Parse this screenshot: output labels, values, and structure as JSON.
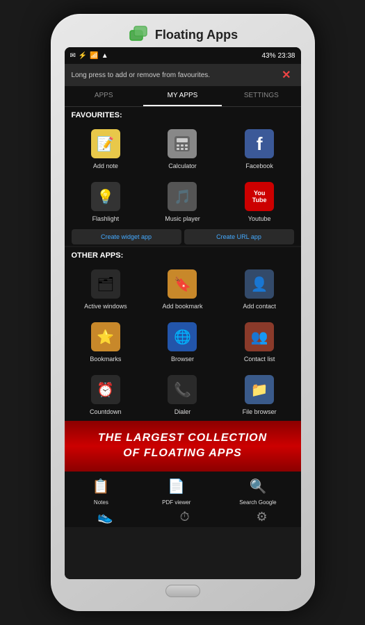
{
  "app": {
    "title": "Floating Apps"
  },
  "statusBar": {
    "time": "23:38",
    "battery": "43%",
    "signal": "▲"
  },
  "notice": {
    "text": "Long press to add or remove from favourites.",
    "closeLabel": "✕"
  },
  "tabs": [
    {
      "label": "APPS",
      "active": false
    },
    {
      "label": "MY APPS",
      "active": true
    },
    {
      "label": "SETTINGS",
      "active": false
    }
  ],
  "favourites": {
    "label": "FAVOURITES:",
    "apps": [
      {
        "name": "Add note",
        "emoji": "📝",
        "bg": "#e8c84a"
      },
      {
        "name": "Calculator",
        "emoji": "🔢",
        "bg": "#888"
      },
      {
        "name": "Facebook",
        "emoji": "f",
        "bg": "#3b5998"
      },
      {
        "name": "Flashlight",
        "emoji": "💡",
        "bg": "#333"
      },
      {
        "name": "Music player",
        "emoji": "🎵",
        "bg": "#555"
      },
      {
        "name": "Youtube",
        "emoji": "▶",
        "bg": "#cc0000"
      }
    ]
  },
  "createButtons": [
    {
      "label": "Create widget app"
    },
    {
      "label": "Create URL app"
    }
  ],
  "otherApps": {
    "label": "OTHER APPS:",
    "apps": [
      {
        "name": "Active windows",
        "emoji": "🗂",
        "bg": "#2a2a2a"
      },
      {
        "name": "Add bookmark",
        "emoji": "🔖",
        "bg": "#c8882a"
      },
      {
        "name": "Add contact",
        "emoji": "👤",
        "bg": "#334a6a"
      },
      {
        "name": "Bookmarks",
        "emoji": "⭐",
        "bg": "#c8882a"
      },
      {
        "name": "Browser",
        "emoji": "🌐",
        "bg": "#2255aa"
      },
      {
        "name": "Contact list",
        "emoji": "👥",
        "bg": "#8a3a2a"
      },
      {
        "name": "Countdown",
        "emoji": "⏰",
        "bg": "#2a2a2a"
      },
      {
        "name": "Dialer",
        "emoji": "📞",
        "bg": "#2a2a2a"
      },
      {
        "name": "File browser",
        "emoji": "📁",
        "bg": "#3a5a8a"
      }
    ]
  },
  "banner": {
    "line1": "THE LARGEST COLLECTION",
    "line2": "OF FLOATING APPS"
  },
  "bottomApps": [
    {
      "name": "Notes",
      "emoji": "📋"
    },
    {
      "name": "PDF viewer",
      "emoji": "📄"
    },
    {
      "name": "Search Google",
      "emoji": "🔍"
    }
  ],
  "moreIcons": [
    "👟",
    "⏱",
    "⚙"
  ]
}
